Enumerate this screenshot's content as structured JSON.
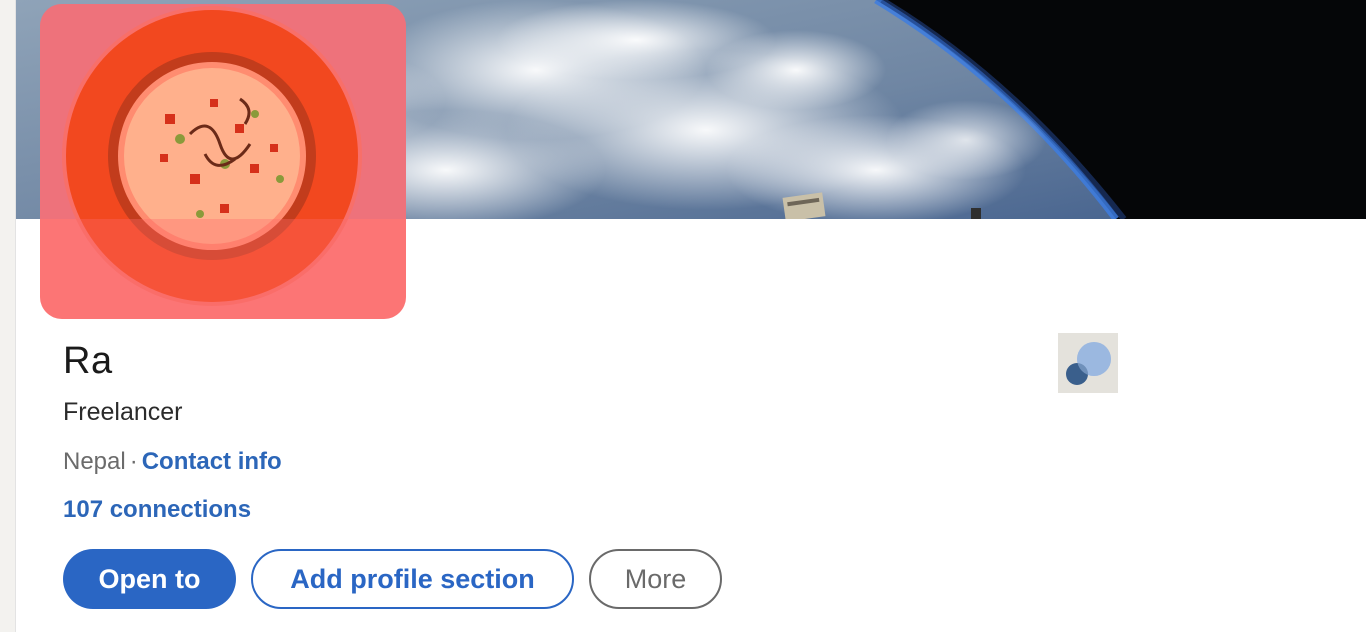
{
  "profile": {
    "name": "Ra",
    "headline": "Freelancer",
    "location": "Nepal",
    "separator": "·",
    "contact_info_label": "Contact info",
    "connections_label": "107 connections"
  },
  "actions": {
    "open_to_label": "Open to",
    "add_section_label": "Add profile section",
    "more_label": "More"
  },
  "images": {
    "cover": "earth-from-space-cover",
    "avatar": "rice-bowl-avatar",
    "company_logo": "generic-company-logo"
  },
  "colors": {
    "accent": "#2a66c4",
    "avatar_bg": "#fb7c7c",
    "muted_text": "#6b6b6b"
  }
}
